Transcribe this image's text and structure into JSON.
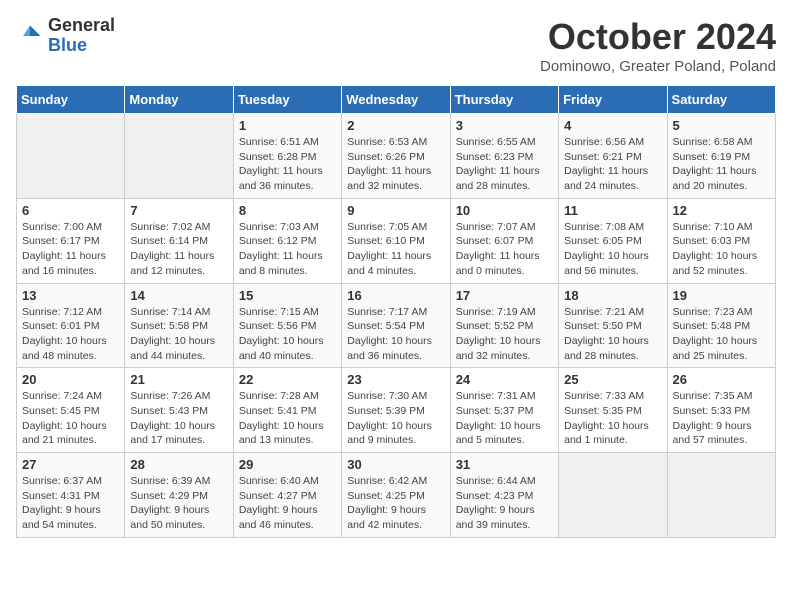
{
  "header": {
    "logo_general": "General",
    "logo_blue": "Blue",
    "month_title": "October 2024",
    "location": "Dominowo, Greater Poland, Poland"
  },
  "weekdays": [
    "Sunday",
    "Monday",
    "Tuesday",
    "Wednesday",
    "Thursday",
    "Friday",
    "Saturday"
  ],
  "weeks": [
    [
      {
        "day": "",
        "detail": ""
      },
      {
        "day": "",
        "detail": ""
      },
      {
        "day": "1",
        "detail": "Sunrise: 6:51 AM\nSunset: 6:28 PM\nDaylight: 11 hours\nand 36 minutes."
      },
      {
        "day": "2",
        "detail": "Sunrise: 6:53 AM\nSunset: 6:26 PM\nDaylight: 11 hours\nand 32 minutes."
      },
      {
        "day": "3",
        "detail": "Sunrise: 6:55 AM\nSunset: 6:23 PM\nDaylight: 11 hours\nand 28 minutes."
      },
      {
        "day": "4",
        "detail": "Sunrise: 6:56 AM\nSunset: 6:21 PM\nDaylight: 11 hours\nand 24 minutes."
      },
      {
        "day": "5",
        "detail": "Sunrise: 6:58 AM\nSunset: 6:19 PM\nDaylight: 11 hours\nand 20 minutes."
      }
    ],
    [
      {
        "day": "6",
        "detail": "Sunrise: 7:00 AM\nSunset: 6:17 PM\nDaylight: 11 hours\nand 16 minutes."
      },
      {
        "day": "7",
        "detail": "Sunrise: 7:02 AM\nSunset: 6:14 PM\nDaylight: 11 hours\nand 12 minutes."
      },
      {
        "day": "8",
        "detail": "Sunrise: 7:03 AM\nSunset: 6:12 PM\nDaylight: 11 hours\nand 8 minutes."
      },
      {
        "day": "9",
        "detail": "Sunrise: 7:05 AM\nSunset: 6:10 PM\nDaylight: 11 hours\nand 4 minutes."
      },
      {
        "day": "10",
        "detail": "Sunrise: 7:07 AM\nSunset: 6:07 PM\nDaylight: 11 hours\nand 0 minutes."
      },
      {
        "day": "11",
        "detail": "Sunrise: 7:08 AM\nSunset: 6:05 PM\nDaylight: 10 hours\nand 56 minutes."
      },
      {
        "day": "12",
        "detail": "Sunrise: 7:10 AM\nSunset: 6:03 PM\nDaylight: 10 hours\nand 52 minutes."
      }
    ],
    [
      {
        "day": "13",
        "detail": "Sunrise: 7:12 AM\nSunset: 6:01 PM\nDaylight: 10 hours\nand 48 minutes."
      },
      {
        "day": "14",
        "detail": "Sunrise: 7:14 AM\nSunset: 5:58 PM\nDaylight: 10 hours\nand 44 minutes."
      },
      {
        "day": "15",
        "detail": "Sunrise: 7:15 AM\nSunset: 5:56 PM\nDaylight: 10 hours\nand 40 minutes."
      },
      {
        "day": "16",
        "detail": "Sunrise: 7:17 AM\nSunset: 5:54 PM\nDaylight: 10 hours\nand 36 minutes."
      },
      {
        "day": "17",
        "detail": "Sunrise: 7:19 AM\nSunset: 5:52 PM\nDaylight: 10 hours\nand 32 minutes."
      },
      {
        "day": "18",
        "detail": "Sunrise: 7:21 AM\nSunset: 5:50 PM\nDaylight: 10 hours\nand 28 minutes."
      },
      {
        "day": "19",
        "detail": "Sunrise: 7:23 AM\nSunset: 5:48 PM\nDaylight: 10 hours\nand 25 minutes."
      }
    ],
    [
      {
        "day": "20",
        "detail": "Sunrise: 7:24 AM\nSunset: 5:45 PM\nDaylight: 10 hours\nand 21 minutes."
      },
      {
        "day": "21",
        "detail": "Sunrise: 7:26 AM\nSunset: 5:43 PM\nDaylight: 10 hours\nand 17 minutes."
      },
      {
        "day": "22",
        "detail": "Sunrise: 7:28 AM\nSunset: 5:41 PM\nDaylight: 10 hours\nand 13 minutes."
      },
      {
        "day": "23",
        "detail": "Sunrise: 7:30 AM\nSunset: 5:39 PM\nDaylight: 10 hours\nand 9 minutes."
      },
      {
        "day": "24",
        "detail": "Sunrise: 7:31 AM\nSunset: 5:37 PM\nDaylight: 10 hours\nand 5 minutes."
      },
      {
        "day": "25",
        "detail": "Sunrise: 7:33 AM\nSunset: 5:35 PM\nDaylight: 10 hours\nand 1 minute."
      },
      {
        "day": "26",
        "detail": "Sunrise: 7:35 AM\nSunset: 5:33 PM\nDaylight: 9 hours\nand 57 minutes."
      }
    ],
    [
      {
        "day": "27",
        "detail": "Sunrise: 6:37 AM\nSunset: 4:31 PM\nDaylight: 9 hours\nand 54 minutes."
      },
      {
        "day": "28",
        "detail": "Sunrise: 6:39 AM\nSunset: 4:29 PM\nDaylight: 9 hours\nand 50 minutes."
      },
      {
        "day": "29",
        "detail": "Sunrise: 6:40 AM\nSunset: 4:27 PM\nDaylight: 9 hours\nand 46 minutes."
      },
      {
        "day": "30",
        "detail": "Sunrise: 6:42 AM\nSunset: 4:25 PM\nDaylight: 9 hours\nand 42 minutes."
      },
      {
        "day": "31",
        "detail": "Sunrise: 6:44 AM\nSunset: 4:23 PM\nDaylight: 9 hours\nand 39 minutes."
      },
      {
        "day": "",
        "detail": ""
      },
      {
        "day": "",
        "detail": ""
      }
    ]
  ]
}
